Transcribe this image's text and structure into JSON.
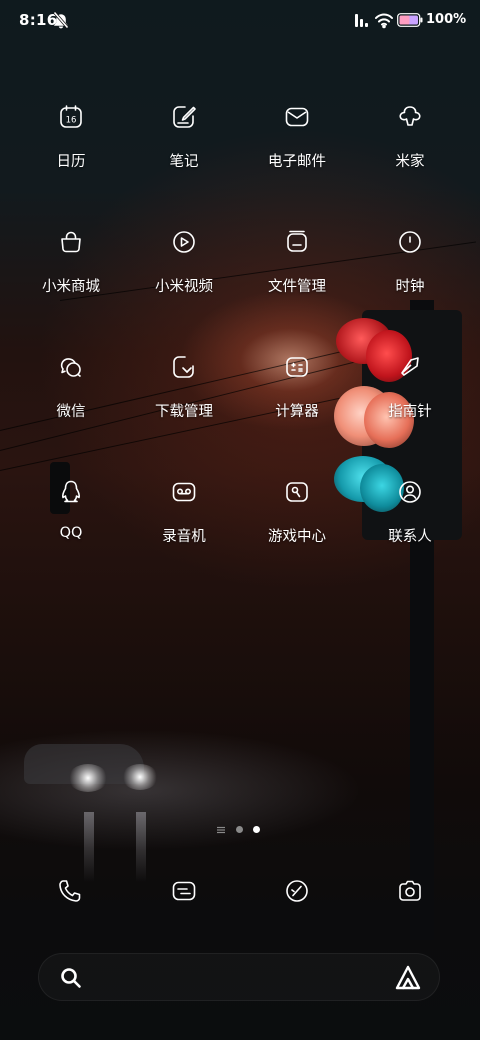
{
  "status_bar": {
    "time": "8:16",
    "battery_percent": "100%",
    "icons": [
      "mute-icon",
      "signal-icon",
      "wifi-icon",
      "battery-icon"
    ]
  },
  "apps": [
    {
      "label": "日历",
      "icon": "calendar-icon",
      "badge": "16"
    },
    {
      "label": "笔记",
      "icon": "notes-icon"
    },
    {
      "label": "电子邮件",
      "icon": "mail-icon"
    },
    {
      "label": "米家",
      "icon": "mijia-icon"
    },
    {
      "label": "小米商城",
      "icon": "shopping-bag-icon"
    },
    {
      "label": "小米视频",
      "icon": "video-icon"
    },
    {
      "label": "文件管理",
      "icon": "folder-icon"
    },
    {
      "label": "时钟",
      "icon": "clock-icon"
    },
    {
      "label": "微信",
      "icon": "wechat-icon"
    },
    {
      "label": "下载管理",
      "icon": "download-icon"
    },
    {
      "label": "计算器",
      "icon": "calculator-icon"
    },
    {
      "label": "指南针",
      "icon": "compass-icon"
    },
    {
      "label": "QQ",
      "icon": "qq-penguin-icon"
    },
    {
      "label": "录音机",
      "icon": "recorder-icon"
    },
    {
      "label": "游戏中心",
      "icon": "game-center-icon"
    },
    {
      "label": "联系人",
      "icon": "contacts-icon"
    }
  ],
  "page_indicator": {
    "pages": 2,
    "current_page": 2
  },
  "dock": [
    {
      "icon": "phone-icon"
    },
    {
      "icon": "messages-icon"
    },
    {
      "icon": "browser-icon"
    },
    {
      "icon": "camera-icon"
    }
  ],
  "search_bar": {
    "icons": [
      "search-icon",
      "assistant-icon"
    ]
  },
  "colors": {
    "text": "#ffffff",
    "icon_stroke": "#ffffff",
    "dot_active": "#ffffff",
    "dot_inactive": "#8a8a8a"
  }
}
